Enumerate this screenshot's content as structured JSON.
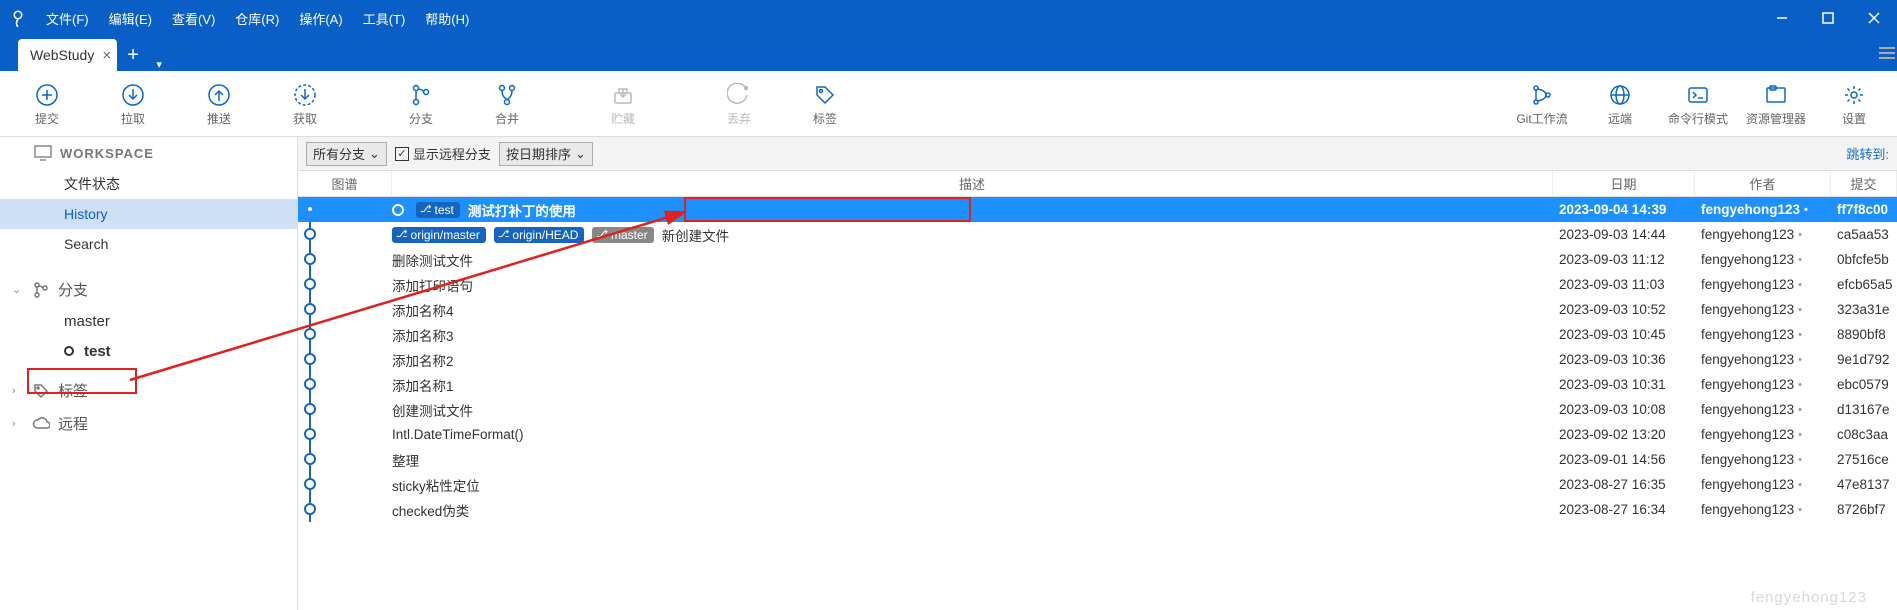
{
  "menu": {
    "file": "文件(F)",
    "edit": "编辑(E)",
    "view": "查看(V)",
    "repo": "仓库(R)",
    "action": "操作(A)",
    "tool": "工具(T)",
    "help": "帮助(H)"
  },
  "tab": {
    "name": "WebStudy"
  },
  "toolbar": {
    "commit": "提交",
    "pull": "拉取",
    "push": "推送",
    "fetch": "获取",
    "branch": "分支",
    "merge": "合并",
    "stash": "贮藏",
    "discard": "丢弃",
    "tag": "标签",
    "gitflow": "Git工作流",
    "remote": "远端",
    "terminal": "命令行模式",
    "explorer": "资源管理器",
    "settings": "设置"
  },
  "filter": {
    "branches": "所有分支",
    "showRemote": "显示远程分支",
    "sort": "按日期排序",
    "jump": "跳转到:"
  },
  "sidebar": {
    "workspace": "WORKSPACE",
    "fileStatus": "文件状态",
    "history": "History",
    "search": "Search",
    "branches": "分支",
    "branch_master": "master",
    "branch_test": "test",
    "tags": "标签",
    "remotes": "远程"
  },
  "headers": {
    "graph": "图谱",
    "desc": "描述",
    "date": "日期",
    "author": "作者",
    "commit": "提交"
  },
  "tags": {
    "test": "test",
    "origin_master": "origin/master",
    "origin_head": "origin/HEAD",
    "master": "master"
  },
  "commits": [
    {
      "desc": "测试打补丁的使用",
      "date": "2023-09-04 14:39",
      "author": "fengyehong123",
      "hash": "ff7f8c00"
    },
    {
      "desc": "新创建文件",
      "date": "2023-09-03 14:44",
      "author": "fengyehong123",
      "hash": "ca5aa53"
    },
    {
      "desc": "删除测试文件",
      "date": "2023-09-03 11:12",
      "author": "fengyehong123",
      "hash": "0bfcfe5b"
    },
    {
      "desc": "添加打印语句",
      "date": "2023-09-03 11:03",
      "author": "fengyehong123",
      "hash": "efcb65a5"
    },
    {
      "desc": "添加名称4",
      "date": "2023-09-03 10:52",
      "author": "fengyehong123",
      "hash": "323a31e"
    },
    {
      "desc": "添加名称3",
      "date": "2023-09-03 10:45",
      "author": "fengyehong123",
      "hash": "8890bf8"
    },
    {
      "desc": "添加名称2",
      "date": "2023-09-03 10:36",
      "author": "fengyehong123",
      "hash": "9e1d792"
    },
    {
      "desc": "添加名称1",
      "date": "2023-09-03 10:31",
      "author": "fengyehong123",
      "hash": "ebc0579"
    },
    {
      "desc": "创建测试文件",
      "date": "2023-09-03 10:08",
      "author": "fengyehong123",
      "hash": "d13167e"
    },
    {
      "desc": "Intl.DateTimeFormat()",
      "date": "2023-09-02 13:20",
      "author": "fengyehong123",
      "hash": "c08c3aa"
    },
    {
      "desc": "整理",
      "date": "2023-09-01 14:56",
      "author": "fengyehong123",
      "hash": "27516ce"
    },
    {
      "desc": "sticky粘性定位",
      "date": "2023-08-27 16:35",
      "author": "fengyehong123",
      "hash": "47e8137"
    },
    {
      "desc": "checked伪类",
      "date": "2023-08-27 16:34",
      "author": "fengyehong123",
      "hash": "8726bf7"
    }
  ],
  "watermark": "fengyehong123"
}
